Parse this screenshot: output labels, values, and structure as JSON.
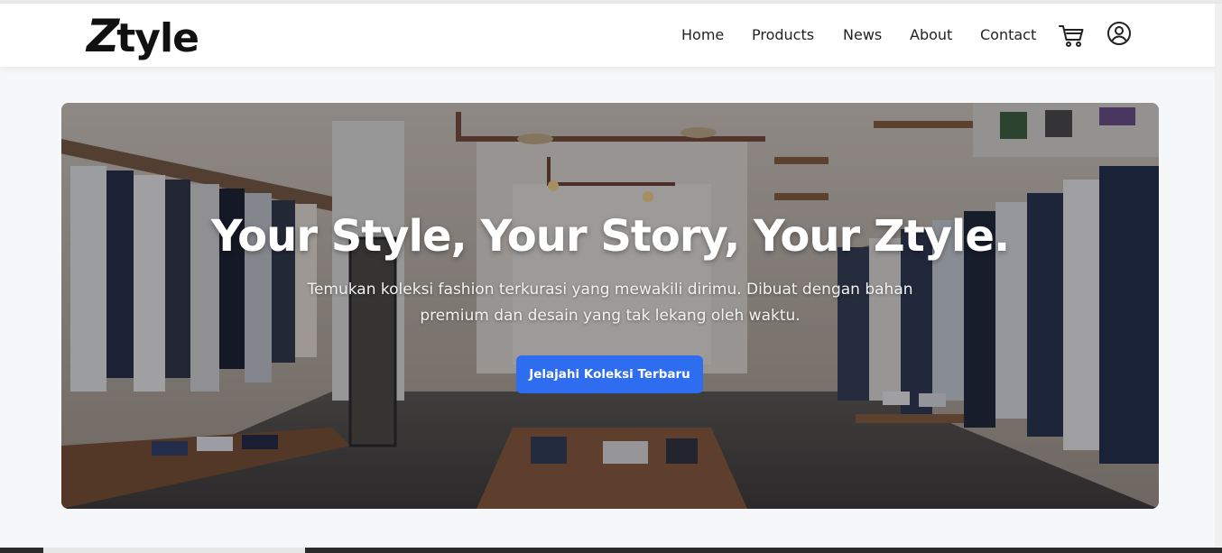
{
  "brand": {
    "logo_z": "Z",
    "logo_rest": "tyle"
  },
  "nav": {
    "items": [
      {
        "label": "Home"
      },
      {
        "label": "Products"
      },
      {
        "label": "News"
      },
      {
        "label": "About"
      },
      {
        "label": "Contact"
      }
    ],
    "icons": {
      "cart": "cart-icon",
      "account": "user-circle-icon"
    }
  },
  "hero": {
    "title": "Your Style, Your Story, Your Ztyle.",
    "subtitle": "Temukan koleksi fashion terkurasi yang mewakili dirimu. Dibuat dengan bahan premium dan desain yang tak lekang oleh waktu.",
    "cta_label": "Jelajahi Koleksi Terbaru"
  },
  "colors": {
    "accent": "#2f6df0",
    "nav_bg": "#ffffff",
    "page_bg": "#f6f7f9"
  }
}
